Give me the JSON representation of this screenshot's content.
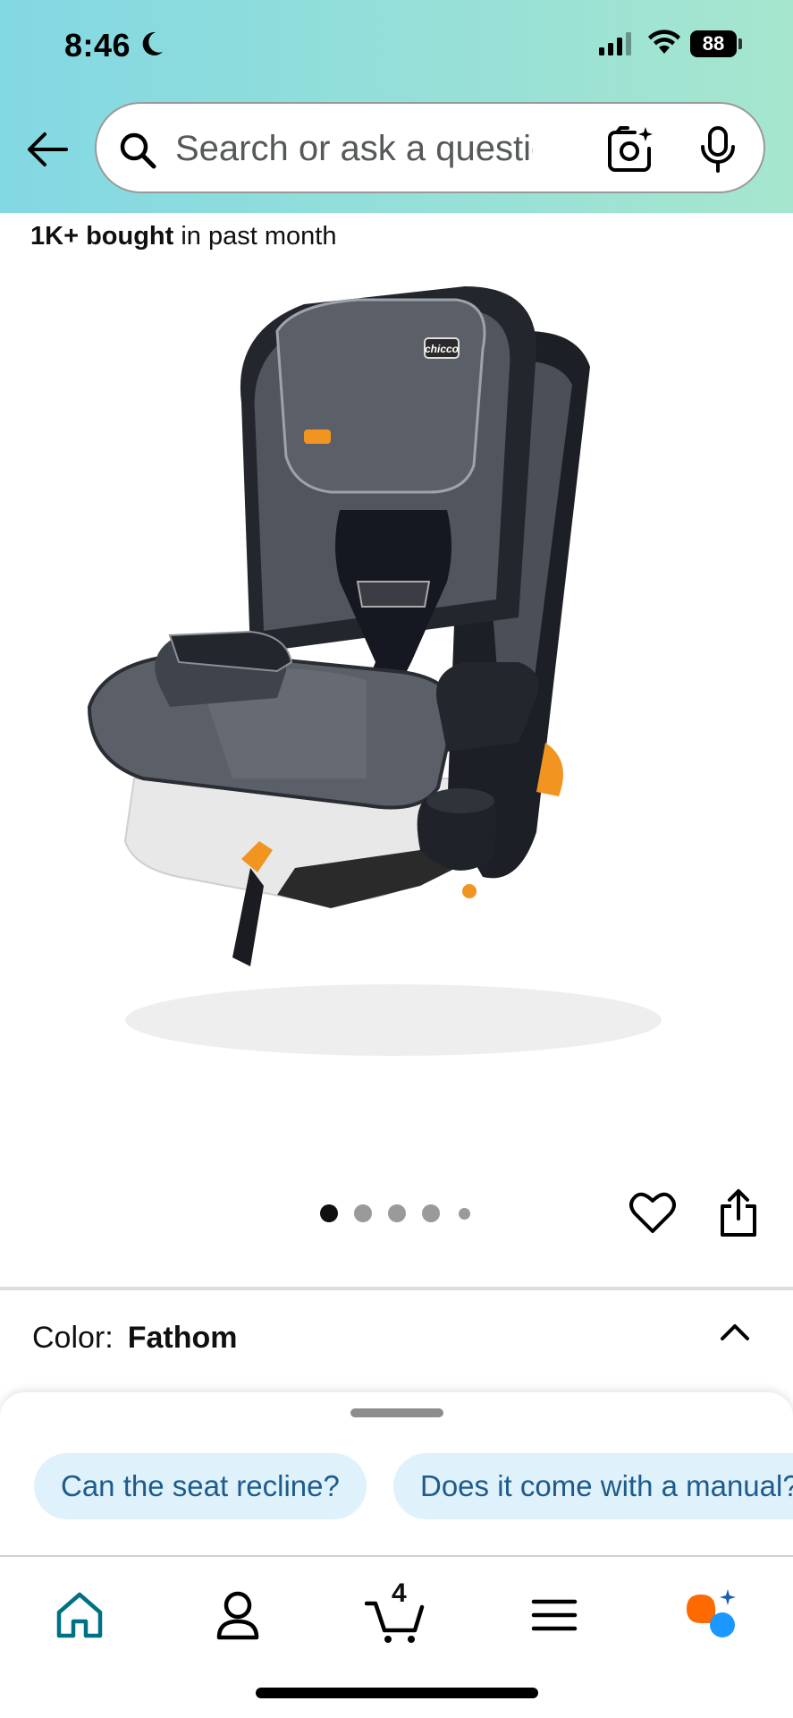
{
  "status_bar": {
    "time": "8:46",
    "battery": "88",
    "icons": [
      "moon-icon",
      "signal-icon",
      "wifi-icon",
      "battery-icon"
    ]
  },
  "header": {
    "back_icon": "back-arrow-icon",
    "search": {
      "placeholder": "Search or ask a question",
      "value": ""
    },
    "camera_icon": "camera-icon",
    "mic_icon": "microphone-icon",
    "gradient_colors": [
      "#82d8e3",
      "#a6e6ce"
    ]
  },
  "product": {
    "bought_bold": "1K+ bought",
    "bought_rest": " in past month",
    "image_alt": "Chicco MyFit car seat",
    "brand_on_seat": "chicco",
    "carousel": {
      "total_dots": 5,
      "active_index": 0
    },
    "wishlist_icon": "heart-icon",
    "share_icon": "share-icon"
  },
  "color": {
    "label": "Color:",
    "value": "Fathom"
  },
  "suggestions": {
    "chips": [
      "Can the seat recline?",
      "Does it come with a manual?"
    ]
  },
  "bottom_nav": {
    "items": [
      {
        "name": "home",
        "icon": "home-icon",
        "active": true
      },
      {
        "name": "account",
        "icon": "person-icon",
        "active": false
      },
      {
        "name": "cart",
        "icon": "cart-icon",
        "count": "4",
        "active": false
      },
      {
        "name": "menu",
        "icon": "menu-icon",
        "active": false
      },
      {
        "name": "rufus",
        "icon": "rufus-icon",
        "active": false
      }
    ],
    "accent_color": "#007185"
  }
}
